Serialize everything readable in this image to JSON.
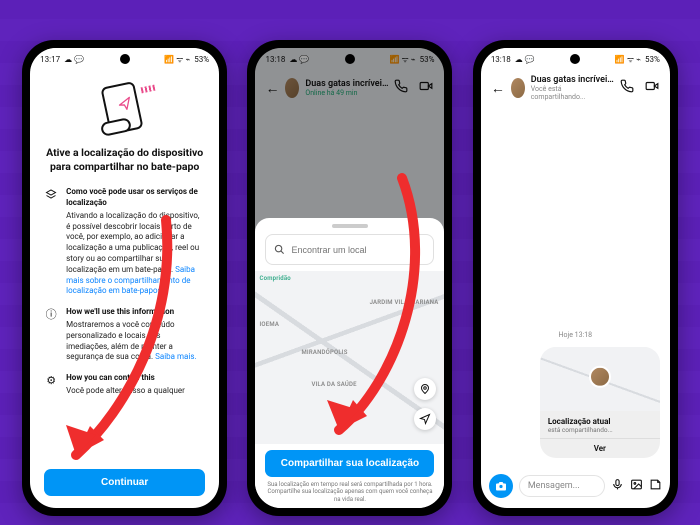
{
  "status": {
    "time": "13:17",
    "time2": "13:18",
    "time3": "13:18",
    "battery": "53%",
    "sigs": "📶 ᯤ ⌁"
  },
  "phone1": {
    "title": "Ative a localização do dispositivo para compartilhar no bate-papo",
    "s1h": "Como você pode usar os serviços de localização",
    "s1b": "Ativando a localização do dispositivo, é possível descobrir locais perto de você, por exemplo, ao adicionar a localização a uma publicação, reel ou story ou ao compartilhar sua localização em um bate-papo. ",
    "s1link": "Saiba mais sobre o compartilhamento de localização em bate-papos.",
    "s2h": "How we'll use this information",
    "s2b": "Mostraremos a você conteúdo personalizado e locais nas imediações, além de manter a segurança de sua conta. ",
    "s2link": "Saiba mais.",
    "s3h": "How you can control this",
    "s3b": "Você pode alterar isso a qualquer",
    "button": "Continuar"
  },
  "phone2": {
    "chat_name": "Duas gatas incrívei…",
    "chat_status": "Online há 49 min",
    "search_placeholder": "Encontrar um local",
    "labels": {
      "a": "JARDIM VILA MARIANA",
      "b": "MIRANDÓPOLIS",
      "c": "VILA DA SAÚDE",
      "d": "IOEMA",
      "e": "Compridão"
    },
    "button": "Compartilhar sua localização",
    "footer": "Sua localização em tempo real será compartilhada por 1 hora. Compartilhe sua localização apenas com quem você conheça na vida real."
  },
  "phone3": {
    "chat_name": "Duas gatas incrívei…",
    "chat_status": "Você está compartilhando...",
    "time_label": "Hoje 13:18",
    "card_title": "Localização atual",
    "card_sub": "está compartilhando...",
    "card_action": "Ver",
    "msg_placeholder": "Mensagem..."
  }
}
